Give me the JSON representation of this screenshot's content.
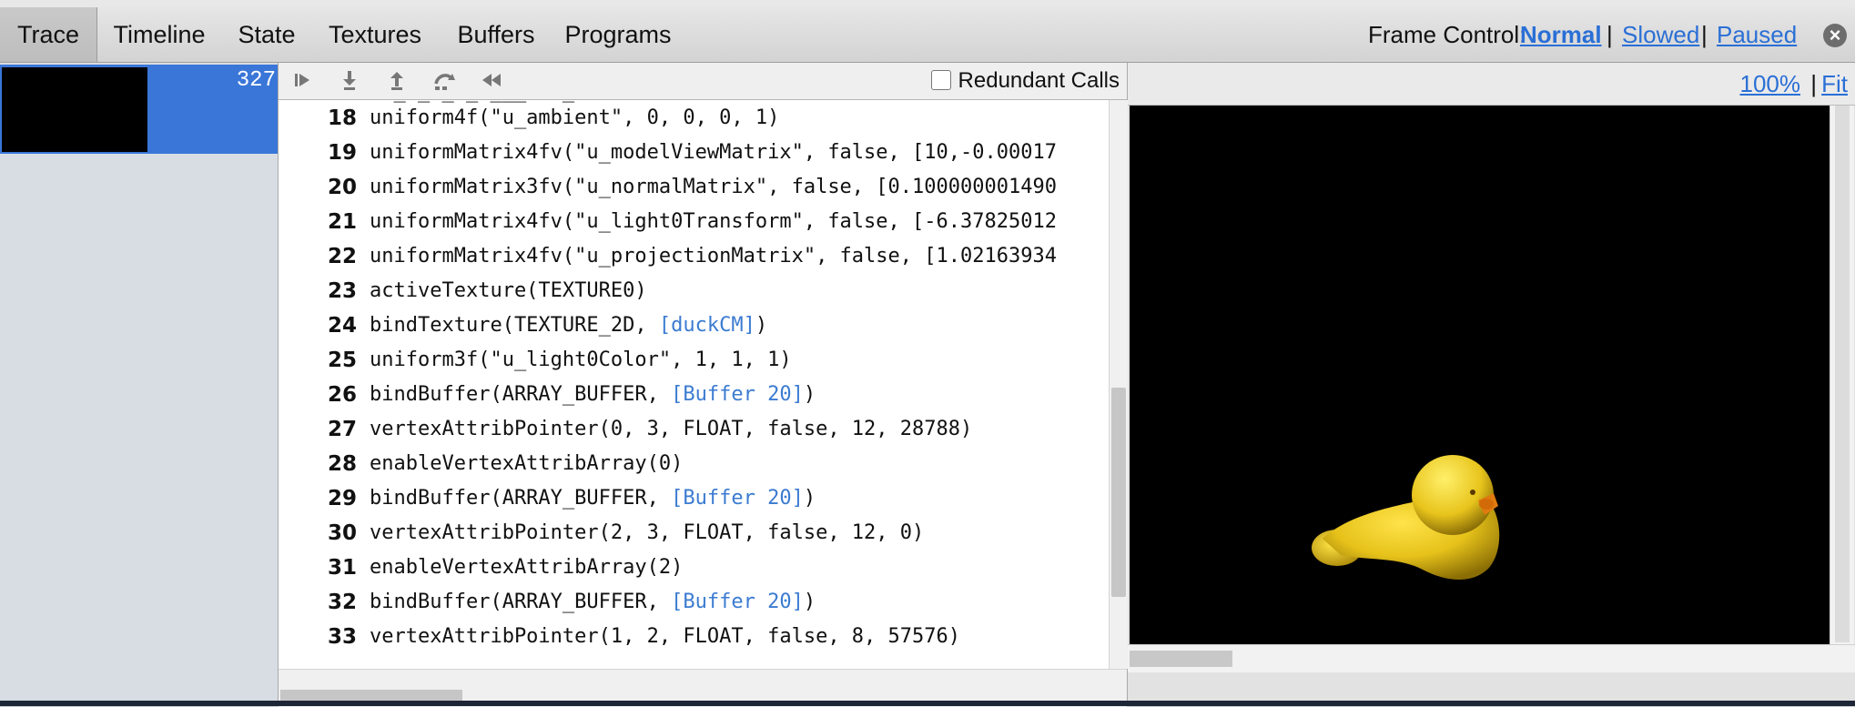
{
  "tabs": [
    {
      "label": "Trace",
      "active": true
    },
    {
      "label": "Timeline"
    },
    {
      "label": "State"
    },
    {
      "label": "Textures"
    },
    {
      "label": "Buffers"
    },
    {
      "label": "Programs"
    }
  ],
  "frame_control": {
    "label": "Frame Control:",
    "options": [
      "Normal",
      "Slowed",
      "Paused"
    ],
    "selected": "Normal",
    "separator": "|"
  },
  "frames": [
    {
      "number": "327"
    }
  ],
  "toolbar": {
    "icons": [
      "step-forward-icon",
      "step-into-icon",
      "step-out-icon",
      "step-over-icon",
      "rewind-icon"
    ],
    "redundant_calls_label": "Redundant Calls",
    "redundant_calls_checked": false
  },
  "calls": [
    {
      "num": "18",
      "parts": [
        {
          "t": "uniform4f(\"u_ambient\", 0, 0, 0, 1)"
        }
      ]
    },
    {
      "num": "19",
      "parts": [
        {
          "t": "uniformMatrix4fv(\"u_modelViewMatrix\", false, [10,-0.00017"
        }
      ]
    },
    {
      "num": "20",
      "parts": [
        {
          "t": "uniformMatrix3fv(\"u_normalMatrix\", false, [0.100000001490"
        }
      ]
    },
    {
      "num": "21",
      "parts": [
        {
          "t": "uniformMatrix4fv(\"u_light0Transform\", false, [-6.37825012"
        }
      ]
    },
    {
      "num": "22",
      "parts": [
        {
          "t": "uniformMatrix4fv(\"u_projectionMatrix\", false, [1.02163934"
        }
      ]
    },
    {
      "num": "23",
      "parts": [
        {
          "t": "activeTexture(TEXTURE0)"
        }
      ]
    },
    {
      "num": "24",
      "parts": [
        {
          "t": "bindTexture(TEXTURE_2D, "
        },
        {
          "t": "[duckCM]",
          "link": true
        },
        {
          "t": ")"
        }
      ]
    },
    {
      "num": "25",
      "parts": [
        {
          "t": "uniform3f(\"u_light0Color\", 1, 1, 1)"
        }
      ]
    },
    {
      "num": "26",
      "parts": [
        {
          "t": "bindBuffer(ARRAY_BUFFER, "
        },
        {
          "t": "[Buffer 20]",
          "link": true
        },
        {
          "t": ")"
        }
      ]
    },
    {
      "num": "27",
      "parts": [
        {
          "t": "vertexAttribPointer(0, 3, FLOAT, false, 12, 28788)"
        }
      ]
    },
    {
      "num": "28",
      "parts": [
        {
          "t": "enableVertexAttribArray(0)"
        }
      ]
    },
    {
      "num": "29",
      "parts": [
        {
          "t": "bindBuffer(ARRAY_BUFFER, "
        },
        {
          "t": "[Buffer 20]",
          "link": true
        },
        {
          "t": ")"
        }
      ]
    },
    {
      "num": "30",
      "parts": [
        {
          "t": "vertexAttribPointer(2, 3, FLOAT, false, 12, 0)"
        }
      ]
    },
    {
      "num": "31",
      "parts": [
        {
          "t": "enableVertexAttribArray(2)"
        }
      ]
    },
    {
      "num": "32",
      "parts": [
        {
          "t": "bindBuffer(ARRAY_BUFFER, "
        },
        {
          "t": "[Buffer 20]",
          "link": true
        },
        {
          "t": ")"
        }
      ]
    },
    {
      "num": "33",
      "parts": [
        {
          "t": "vertexAttribPointer(1, 2, FLOAT, false, 8, 57576)"
        }
      ]
    }
  ],
  "preview": {
    "zoom_label": "100%",
    "fit_label": "Fit",
    "separator": "|",
    "colors": {
      "duck": "#e6c21a",
      "beak": "#e07a10",
      "background": "#000000"
    }
  }
}
